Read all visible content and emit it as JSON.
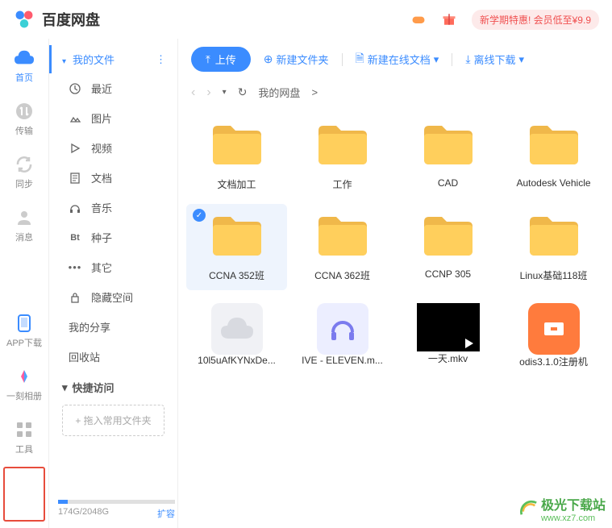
{
  "header": {
    "app_name": "百度网盘",
    "promo": "新学期特惠! 会员低至¥9.9"
  },
  "nav_rail": [
    {
      "label": "首页",
      "active": true
    },
    {
      "label": "传输"
    },
    {
      "label": "同步"
    },
    {
      "label": "消息"
    }
  ],
  "nav_rail_bottom": [
    {
      "label": "APP下载"
    },
    {
      "label": "一刻相册"
    },
    {
      "label": "工具"
    }
  ],
  "sidebar": {
    "my_files": "我的文件",
    "categories": [
      {
        "icon": "clock",
        "label": "最近"
      },
      {
        "icon": "image",
        "label": "图片"
      },
      {
        "icon": "play",
        "label": "视频"
      },
      {
        "icon": "doc",
        "label": "文档"
      },
      {
        "icon": "headphone",
        "label": "音乐"
      },
      {
        "icon": "bt",
        "label": "种子"
      },
      {
        "icon": "more",
        "label": "其它"
      },
      {
        "icon": "lock",
        "label": "隐藏空间"
      }
    ],
    "my_share": "我的分享",
    "recycle": "回收站",
    "quick_access": "快捷访问",
    "drag_hint": "+ 拖入常用文件夹",
    "storage_used": "174G",
    "storage_total": "2048G",
    "storage_sep": "/",
    "expand": "扩容",
    "storage_pct": 8.5
  },
  "toolbar": {
    "upload": "上传",
    "new_folder": "新建文件夹",
    "new_online_doc": "新建在线文档",
    "offline_download": "离线下载"
  },
  "breadcrumb": {
    "root": "我的网盘",
    "sep": ">"
  },
  "files": [
    {
      "type": "folder",
      "name": "文档加工"
    },
    {
      "type": "folder",
      "name": "工作"
    },
    {
      "type": "folder",
      "name": "CAD"
    },
    {
      "type": "folder",
      "name": "Autodesk Vehicle"
    },
    {
      "type": "folder",
      "name": "CCNA 352班",
      "selected": true
    },
    {
      "type": "folder",
      "name": "CCNA 362班"
    },
    {
      "type": "folder",
      "name": "CCNP 305"
    },
    {
      "type": "folder",
      "name": "Linux基础118班"
    },
    {
      "type": "cloud",
      "name": "10l5uAfKYNxDe..."
    },
    {
      "type": "music",
      "name": "IVE - ELEVEN.m..."
    },
    {
      "type": "video",
      "name": "一天.mkv"
    },
    {
      "type": "app",
      "name": "odis3.1.0注册机"
    }
  ],
  "watermark": {
    "main": "极光下载站",
    "sub": "www.xz7.com"
  }
}
